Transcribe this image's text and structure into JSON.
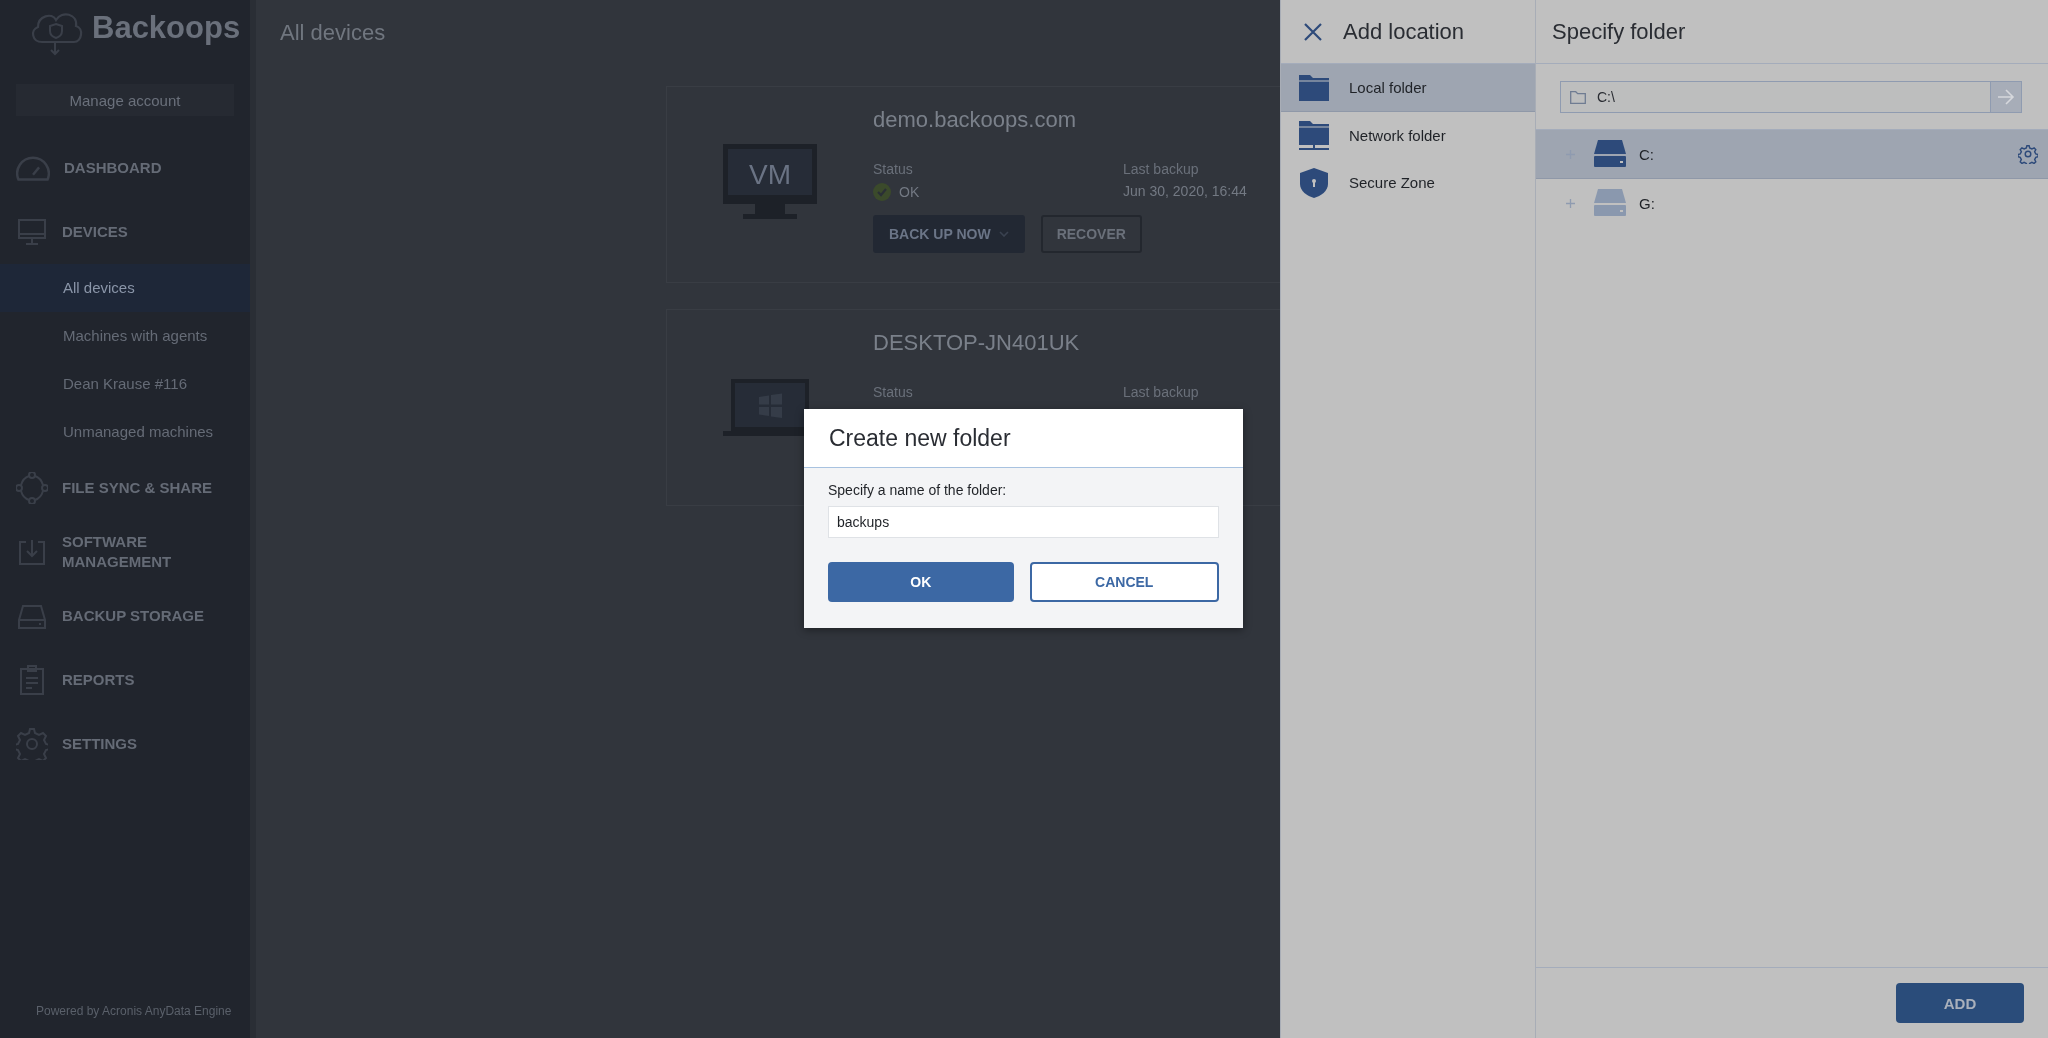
{
  "sidebar": {
    "logo": "Backoops",
    "manage_account": "Manage account",
    "nav": [
      {
        "label": "DASHBOARD",
        "kind": "gauge",
        "selected": false
      },
      {
        "label": "DEVICES",
        "kind": "monitor",
        "selected": false,
        "children": [
          {
            "label": "All devices",
            "selected": true
          },
          {
            "label": "Machines with agents",
            "selected": false
          },
          {
            "label": "Dean Krause #116",
            "selected": false
          },
          {
            "label": "Unmanaged machines",
            "selected": false
          }
        ]
      },
      {
        "label": "FILE SYNC & SHARE",
        "kind": "sync",
        "selected": false
      },
      {
        "label": "SOFTWARE MANAGEMENT",
        "kind": "install",
        "selected": false
      },
      {
        "label": "BACKUP STORAGE",
        "kind": "drive",
        "selected": false
      },
      {
        "label": "REPORTS",
        "kind": "report",
        "selected": false
      },
      {
        "label": "SETTINGS",
        "kind": "gear",
        "selected": false
      }
    ],
    "footer": "Powered by Acronis AnyData Engine"
  },
  "main": {
    "title": "All devices",
    "devices": [
      {
        "name": "demo.backoops.com",
        "kind": "vm",
        "badge": "VM",
        "status_label": "Status",
        "status": "OK",
        "last_backup_label": "Last backup",
        "last_backup": "Jun 30, 2020, 16:44",
        "primary_button": "BACK UP NOW",
        "secondary_button": "RECOVER"
      },
      {
        "name": "DESKTOP-JN401UK",
        "kind": "laptop",
        "status_label": "Status",
        "last_backup_label": "Last backup"
      }
    ]
  },
  "add_location": {
    "title": "Add location",
    "items": [
      {
        "label": "Local folder",
        "kind": "folder",
        "selected": true
      },
      {
        "label": "Network folder",
        "kind": "network",
        "selected": false
      },
      {
        "label": "Secure Zone",
        "kind": "shield",
        "selected": false
      }
    ]
  },
  "specify_folder": {
    "title": "Specify folder",
    "path": "C:\\",
    "tree": [
      {
        "label": "C:",
        "selected": true
      },
      {
        "label": "G:",
        "selected": false
      }
    ],
    "add_button": "ADD"
  },
  "dialog": {
    "title": "Create new folder",
    "label": "Specify a name of the folder:",
    "value": "backups",
    "ok": "OK",
    "cancel": "CANCEL"
  }
}
